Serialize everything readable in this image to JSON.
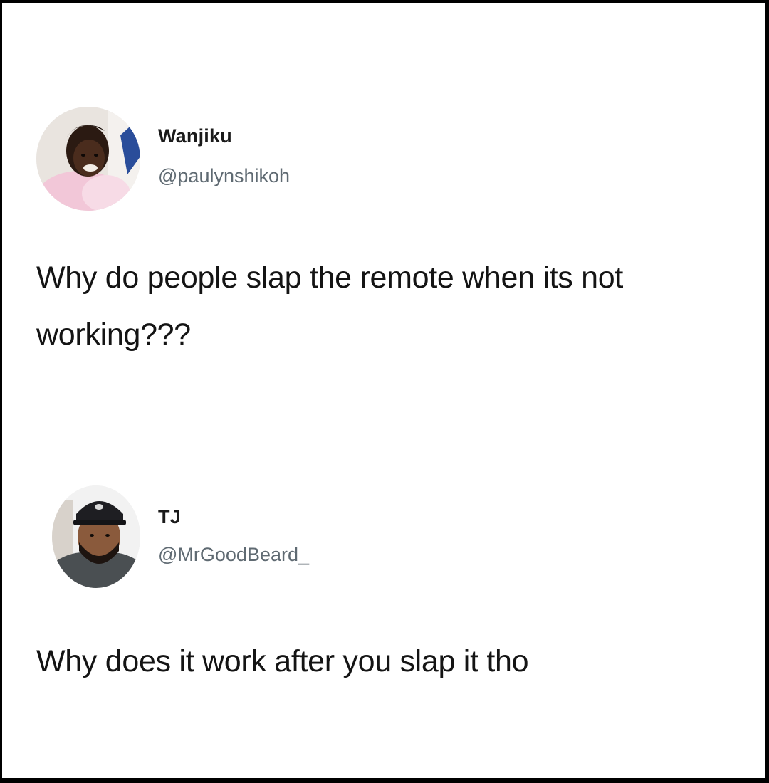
{
  "tweets": [
    {
      "display_name": "Wanjiku",
      "handle": "@paulynshikoh",
      "text": "Why do people slap the remote when its not working???"
    },
    {
      "display_name": "TJ",
      "handle": "@MrGoodBeard_",
      "text": "Why does it work after you slap it tho"
    }
  ]
}
